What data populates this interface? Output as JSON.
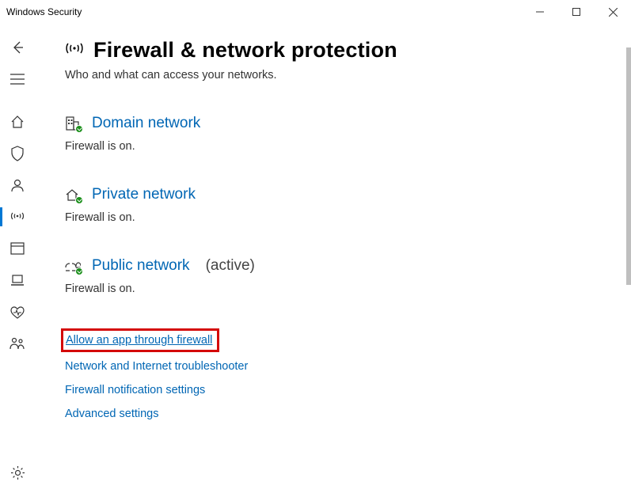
{
  "window": {
    "title": "Windows Security"
  },
  "page": {
    "title": "Firewall & network protection",
    "subtitle": "Who and what can access your networks."
  },
  "networks": {
    "domain": {
      "label": "Domain network",
      "status": "Firewall is on.",
      "active_tag": ""
    },
    "private": {
      "label": "Private network",
      "status": "Firewall is on.",
      "active_tag": ""
    },
    "public": {
      "label": "Public network",
      "status": "Firewall is on.",
      "active_tag": "(active)"
    }
  },
  "links": {
    "allow_app": "Allow an app through firewall",
    "troubleshooter": "Network and Internet troubleshooter",
    "notifications": "Firewall notification settings",
    "advanced": "Advanced settings"
  },
  "sidebar": {
    "back": "back",
    "menu": "menu",
    "home": "home",
    "virus": "virus-threat",
    "account": "account-protection",
    "firewall": "firewall-network",
    "app": "app-browser-control",
    "device": "device-security",
    "perf": "device-performance",
    "family": "family-options",
    "settings": "settings"
  }
}
